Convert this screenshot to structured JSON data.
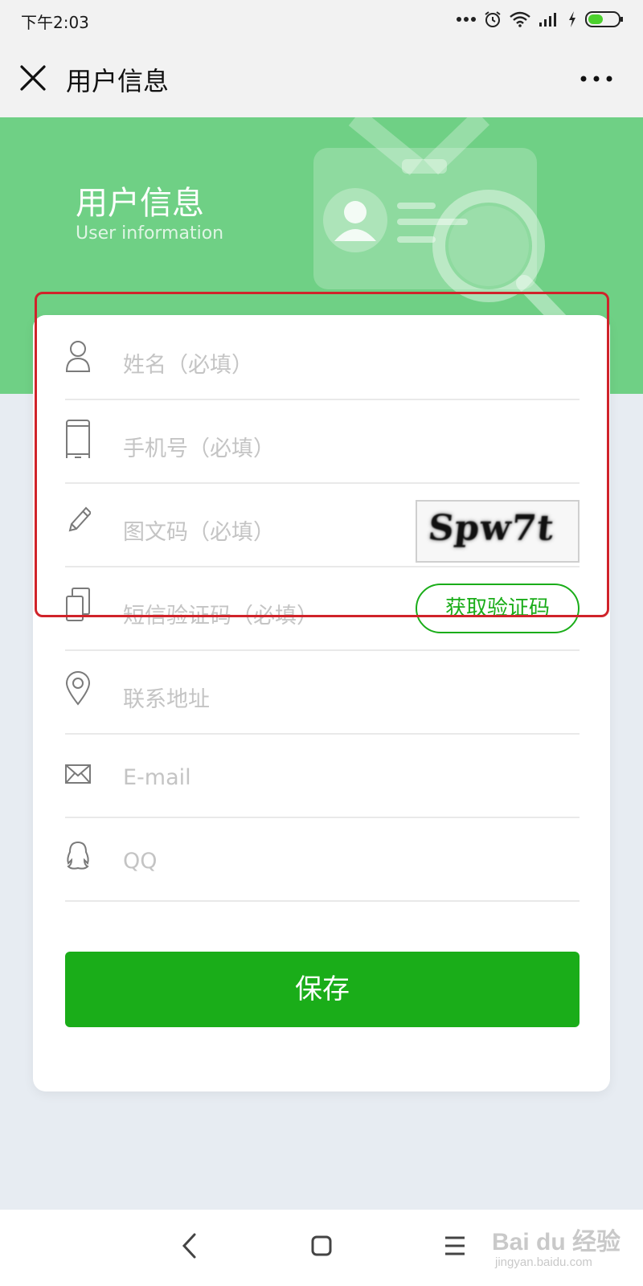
{
  "status_bar": {
    "time": "下午2:03",
    "icons": [
      "more-dots-icon",
      "alarm-icon",
      "wifi-icon",
      "signal-icon",
      "charging-icon",
      "battery-icon"
    ]
  },
  "title_bar": {
    "title": "用户信息",
    "close_icon": "close-icon",
    "more_icon": "more-icon"
  },
  "hero": {
    "title": "用户信息",
    "subtitle": "User information",
    "illustration": "id-card-magnifier-illustration"
  },
  "form": {
    "fields": [
      {
        "name": "name",
        "icon": "user-icon",
        "placeholder": "姓名（必填）"
      },
      {
        "name": "phone",
        "icon": "phone-icon",
        "placeholder": "手机号（必填）"
      },
      {
        "name": "captcha",
        "icon": "pencil-icon",
        "placeholder": "图文码（必填）",
        "captcha_text": "Spw7t"
      },
      {
        "name": "sms",
        "icon": "copy-icon",
        "placeholder": "短信验证码（必填）",
        "button_label": "获取验证码"
      },
      {
        "name": "address",
        "icon": "location-icon",
        "placeholder": "联系地址"
      },
      {
        "name": "email",
        "icon": "mail-icon",
        "placeholder": "E-mail"
      },
      {
        "name": "qq",
        "icon": "qq-icon",
        "placeholder": "QQ"
      }
    ],
    "save_label": "保存"
  },
  "nav_bar": {
    "icons": [
      "back-icon",
      "home-icon",
      "menu-icon"
    ]
  },
  "watermark": {
    "text": "Bai du 经验",
    "sub": "jingyan.baidu.com"
  },
  "colors": {
    "accent": "#1aad19",
    "hero": "#6fd085",
    "highlight": "#d0232a",
    "placeholder": "#c4c4c4"
  }
}
